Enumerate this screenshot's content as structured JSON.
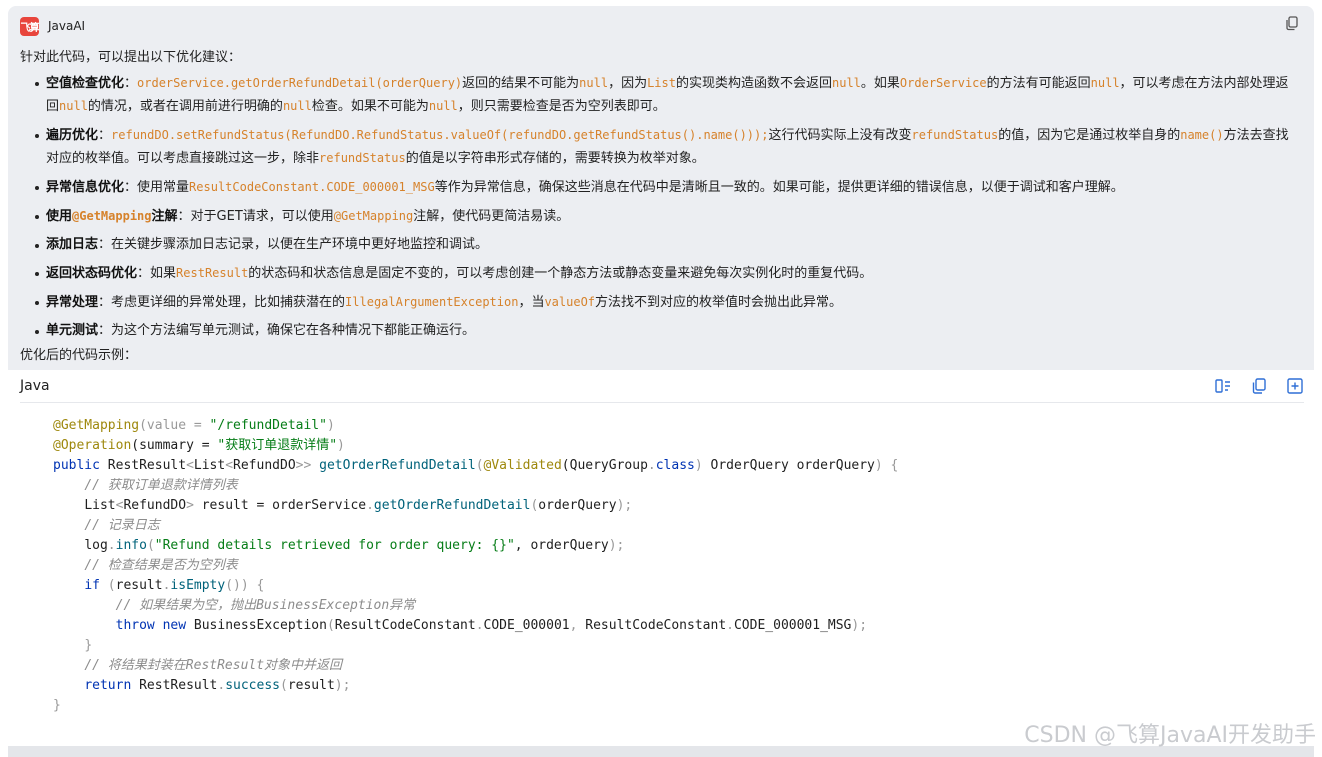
{
  "app": {
    "logo_text": "飞算",
    "name": "JavaAI"
  },
  "icons": {
    "copy": "copy-icon",
    "wrap": "wrap-icon",
    "add": "add-icon"
  },
  "intro": "针对此代码，可以提出以下优化建议：",
  "s1": {
    "title": "空值检查优化",
    "sep": "：",
    "c1": "orderService.getOrderRefundDetail(orderQuery)",
    "t1": "返回的结果不可能为",
    "c2": "null",
    "t2": "，因为",
    "c3": "List",
    "t3": "的实现类构造函数不会返回",
    "c4": "null",
    "t4": "。如果",
    "c5": "OrderService",
    "t5": "的方法有可能返回",
    "c6": "null",
    "t6": "，可以考虑在方法内部处理返回",
    "c7": "null",
    "t7": "的情况，或者在调用前进行明确的",
    "c8": "null",
    "t8": "检查。如果不可能为",
    "c9": "null",
    "t9": "，则只需要检查是否为空列表即可。"
  },
  "s2": {
    "title": "遍历优化",
    "sep": "：",
    "c1": "refundDO.setRefundStatus(RefundDO.RefundStatus.valueOf(refundDO.getRefundStatus().name()));",
    "t1": "这行代码实际上没有改变",
    "c2": "refundStatus",
    "t2": "的值，因为它是通过枚举自身的",
    "c3": "name()",
    "t3": "方法去查找对应的枚举值。可以考虑直接跳过这一步，除非",
    "c4": "refundStatus",
    "t4": "的值是以字符串形式存储的，需要转换为枚举对象。"
  },
  "s3": {
    "title": "异常信息优化",
    "sep": "：",
    "t0": "使用常量",
    "c1": "ResultCodeConstant.CODE_000001_MSG",
    "t1": "等作为异常信息，确保这些消息在代码中是清晰且一致的。如果可能，提供更详细的错误信息，以便于调试和客户理解。"
  },
  "s4": {
    "title_a": "使用",
    "title_c": "@GetMapping",
    "title_b": "注解",
    "sep": "：",
    "t0": "对于GET请求，可以使用",
    "c1": "@GetMapping",
    "t1": "注解，使代码更简洁易读。"
  },
  "s5": {
    "title": "添加日志",
    "sep": "：",
    "t0": "在关键步骤添加日志记录，以便在生产环境中更好地监控和调试。"
  },
  "s6": {
    "title": "返回状态码优化",
    "sep": "：",
    "t0": "如果",
    "c1": "RestResult",
    "t1": "的状态码和状态信息是固定不变的，可以考虑创建一个静态方法或静态变量来避免每次实例化时的重复代码。"
  },
  "s7": {
    "title": "异常处理",
    "sep": "：",
    "t0": "考虑更详细的异常处理，比如捕获潜在的",
    "c1": "IllegalArgumentException",
    "t1": "，当",
    "c2": "valueOf",
    "t2": "方法找不到对应的枚举值时会抛出此异常。"
  },
  "s8": {
    "title": "单元测试",
    "sep": "：",
    "t0": "为这个方法编写单元测试，确保它在各种情况下都能正确运行。"
  },
  "outro": "优化后的代码示例：",
  "code": {
    "language": "Java",
    "l1a": "@GetMapping",
    "l1b": "(value = ",
    "l1c": "\"/refundDetail\"",
    "l1d": ")",
    "l2a": "@Operation",
    "l2b": "(summary = ",
    "l2c": "\"获取订单退款详情\"",
    "l2d": ")",
    "l3a": "public",
    "l3b": " RestResult",
    "l3c": "<",
    "l3d": "List",
    "l3e": "<",
    "l3f": "RefundDO",
    "l3g": ">>",
    "l3h": " ",
    "l3i": "getOrderRefundDetail",
    "l3j": "(",
    "l3k": "@Validated",
    "l3l": "(QueryGroup",
    "l3m": ".",
    "l3n": "class",
    "l3o": ")",
    "l3p": " OrderQuery orderQuery",
    "l3q": ")",
    "l3r": " {",
    "l4": "// 获取订单退款详情列表",
    "l5a": "List",
    "l5b": "<",
    "l5c": "RefundDO",
    "l5d": ">",
    "l5e": " result = orderService",
    "l5f": ".",
    "l5g": "getOrderRefundDetail",
    "l5h": "(",
    "l5i": "orderQuery",
    "l5j": ");",
    "l6": "// 记录日志",
    "l7a": "log",
    "l7b": ".",
    "l7c": "info",
    "l7d": "(",
    "l7e": "\"Refund details retrieved for order query: {}\"",
    "l7f": ", orderQuery",
    "l7g": ");",
    "l8": "// 检查结果是否为空列表",
    "l9a": "if",
    "l9b": " (",
    "l9c": "result",
    "l9d": ".",
    "l9e": "isEmpty",
    "l9f": "()) {",
    "l10": "// 如果结果为空，抛出BusinessException异常",
    "l11a": "throw",
    "l11b": " ",
    "l11c": "new",
    "l11d": " BusinessException",
    "l11e": "(",
    "l11f": "ResultCodeConstant",
    "l11g": ".",
    "l11h": "CODE_000001",
    "l11i": ", ",
    "l11j": "ResultCodeConstant",
    "l11k": ".",
    "l11l": "CODE_000001_MSG",
    "l11m": ");",
    "l12": "}",
    "l13": "// 将结果封装在RestResult对象中并返回",
    "l14a": "return",
    "l14b": " RestResult",
    "l14c": ".",
    "l14d": "success",
    "l14e": "(",
    "l14f": "result",
    "l14g": ");",
    "l15": "}"
  },
  "watermark": "CSDN @飞算JavaAI开发助手"
}
